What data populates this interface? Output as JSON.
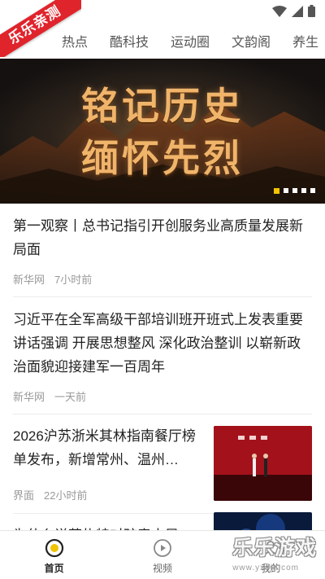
{
  "corner_badge": "乐乐亲测",
  "tabs": [
    "热点",
    "酷科技",
    "运动圈",
    "文韵阁",
    "养生"
  ],
  "banner": {
    "line1": "铭记历史",
    "line2": "缅怀先烈",
    "slide_count": 5,
    "active_slide": 0,
    "accent_color": "#f2c300"
  },
  "feed": {
    "items": [
      {
        "title": "第一观察丨总书记指引开创服务业高质量发展新局面",
        "source": "新华网",
        "time": "7小时前"
      },
      {
        "title": "习近平在全军高级干部培训班开班式上发表重要讲话强调 开展思想整风 深化政治整训 以崭新政治面貌迎接建军一百周年",
        "source": "新华网",
        "time": "一天前"
      },
      {
        "title": "2026沪苏浙米其林指南餐厅榜单发布，新增常州、温州…",
        "source": "界面",
        "time": "22小时前"
      },
      {
        "title": "为什么说草扎特对孩童太早"
      }
    ]
  },
  "bottom_nav": [
    {
      "label": "首页",
      "icon": "home-icon",
      "active": true
    },
    {
      "label": "视频",
      "icon": "play-icon",
      "active": false
    },
    {
      "label": "我的",
      "icon": "user-icon",
      "active": false
    }
  ],
  "watermark": {
    "text": "乐乐游戏",
    "url": "www.yxdill.com"
  }
}
